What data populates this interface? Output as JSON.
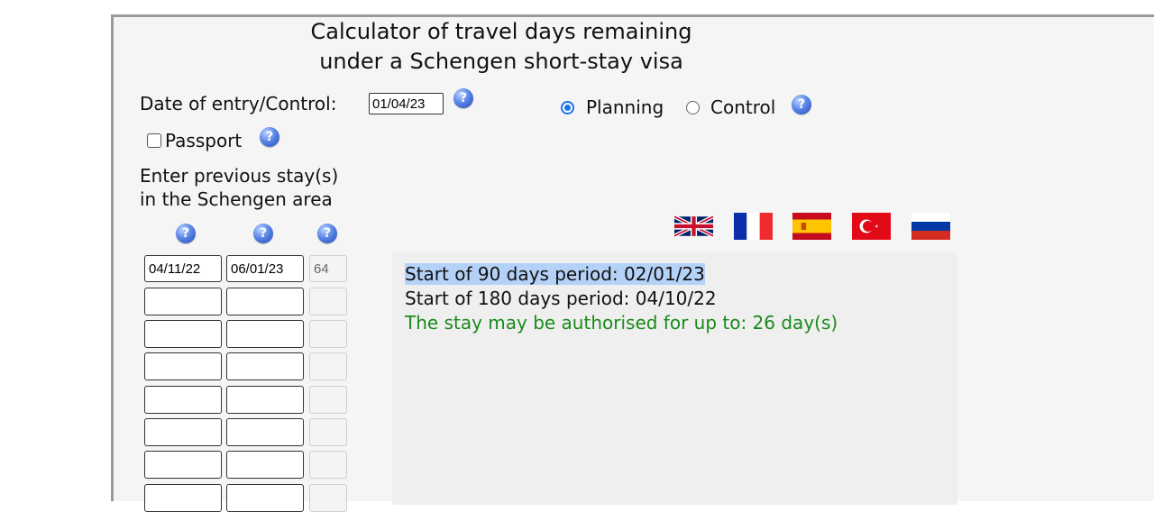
{
  "title": {
    "line1": "Calculator of travel days remaining",
    "line2": "under a Schengen short-stay visa"
  },
  "entry": {
    "label": "Date of entry/Control:",
    "value": "01/04/23"
  },
  "mode": {
    "planning_label": "Planning",
    "control_label": "Control",
    "selected": "Planning"
  },
  "passport": {
    "label": "Passport",
    "checked": false
  },
  "stays": {
    "heading_line1": "Enter previous stay(s)",
    "heading_line2": "in the Schengen area",
    "rows": [
      {
        "start": "04/11/22",
        "end": "06/01/23",
        "days": "64"
      },
      {
        "start": "",
        "end": "",
        "days": ""
      },
      {
        "start": "",
        "end": "",
        "days": ""
      },
      {
        "start": "",
        "end": "",
        "days": ""
      },
      {
        "start": "",
        "end": "",
        "days": ""
      },
      {
        "start": "",
        "end": "",
        "days": ""
      },
      {
        "start": "",
        "end": "",
        "days": ""
      },
      {
        "start": "",
        "end": "",
        "days": ""
      }
    ]
  },
  "languages": [
    "English",
    "French",
    "Spanish",
    "Turkish",
    "Russian"
  ],
  "result": {
    "line1": "Start of 90 days period: 02/01/23",
    "line2": "Start of 180 days period: 04/10/22",
    "line3": "The stay may be authorised for up to: 26 day(s)",
    "highlight_color": "#b4d1f7",
    "success_color": "#1a8a1a"
  },
  "icons": {
    "help": "help-icon"
  }
}
